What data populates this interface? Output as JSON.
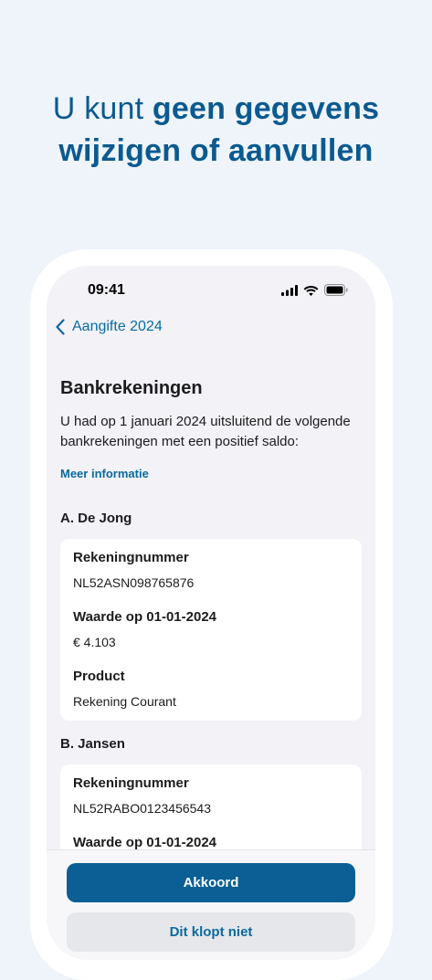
{
  "headline": {
    "part1": "U kunt ",
    "part2": "geen gegevens",
    "part3": "wijzigen of aanvullen"
  },
  "status_bar": {
    "time": "09:41",
    "icons": [
      "signal-icon",
      "wifi-icon",
      "battery-icon"
    ]
  },
  "nav": {
    "back_label": "Aangifte 2024",
    "back_icon": "chevron-left-icon"
  },
  "page": {
    "title": "Bankrekeningen",
    "intro": "U had op 1 januari 2024 uitsluitend de volgende bankrekeningen met een positief saldo:",
    "more_info_link": "Meer informatie"
  },
  "accounts": [
    {
      "owner": "A. De Jong",
      "fields": [
        {
          "label": "Rekeningnummer",
          "value": "NL52ASN098765876"
        },
        {
          "label": "Waarde op 01-01-2024",
          "value": "€ 4.103"
        },
        {
          "label": "Product",
          "value": "Rekening Courant"
        }
      ]
    },
    {
      "owner": "B. Jansen",
      "fields": [
        {
          "label": "Rekeningnummer",
          "value": "NL52RABO0123456543"
        },
        {
          "label": "Waarde op 01-01-2024",
          "value": ""
        }
      ]
    }
  ],
  "actions": {
    "primary": "Akkoord",
    "secondary": "Dit klopt niet"
  },
  "colors": {
    "brand_blue": "#0b5a8f",
    "link_blue": "#0b6a9f",
    "background": "#eef4f9"
  }
}
